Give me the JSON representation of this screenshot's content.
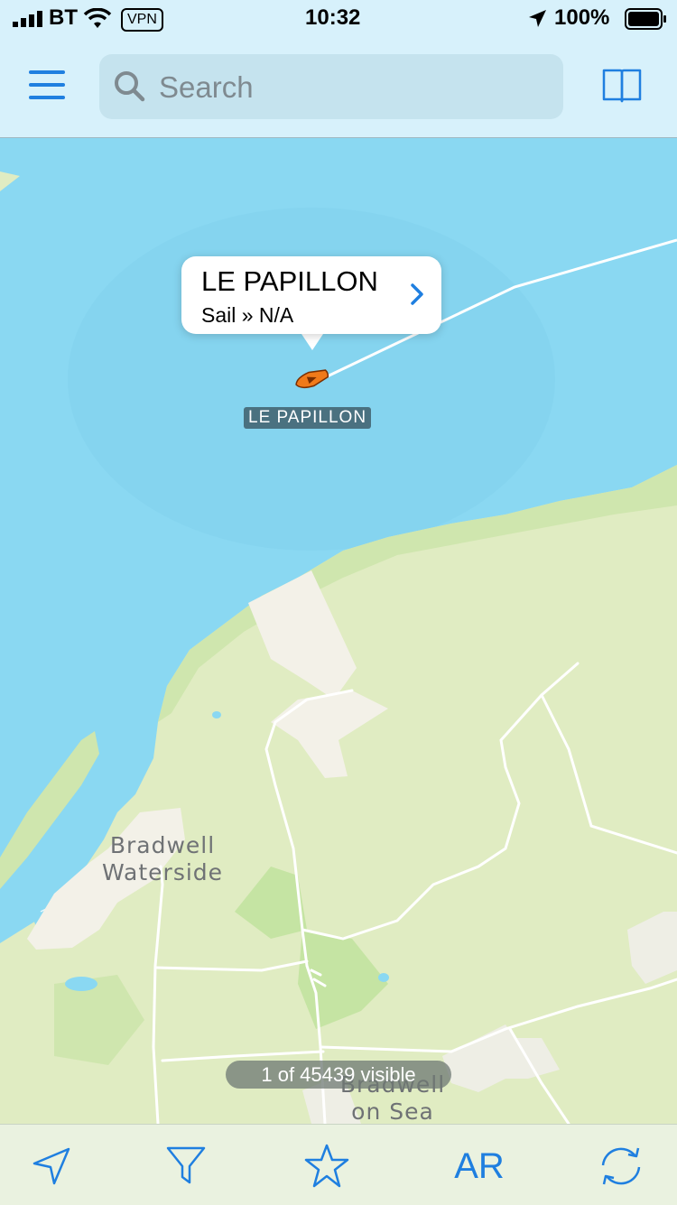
{
  "status": {
    "carrier": "BT",
    "vpn": "VPN",
    "time": "10:32",
    "battery": "100%"
  },
  "header": {
    "menu_icon": "hamburger-menu-icon",
    "search_placeholder": "Search",
    "search_icon": "magnifier-icon",
    "book_icon": "open-book-icon"
  },
  "map": {
    "vessel": {
      "name": "LE PAPILLON",
      "type_line": "Sail » N/A",
      "label": "LE PAPILLON"
    },
    "places": {
      "bradwell_waterside": [
        "Bradwell",
        "Waterside"
      ],
      "bradwell_on_sea": [
        "Bradwell",
        "on Sea"
      ]
    },
    "visible_count": "1 of 45439 visible"
  },
  "tabbar": {
    "locate_icon": "location-arrow-icon",
    "filter_icon": "filter-funnel-icon",
    "favorites_icon": "star-icon",
    "ar_label": "AR",
    "refresh_icon": "refresh-icon"
  },
  "colors": {
    "sea": "#8ad8f2",
    "land": "#e0ecc2",
    "accent": "#1f7fe0",
    "vessel": "#f07a1a"
  }
}
